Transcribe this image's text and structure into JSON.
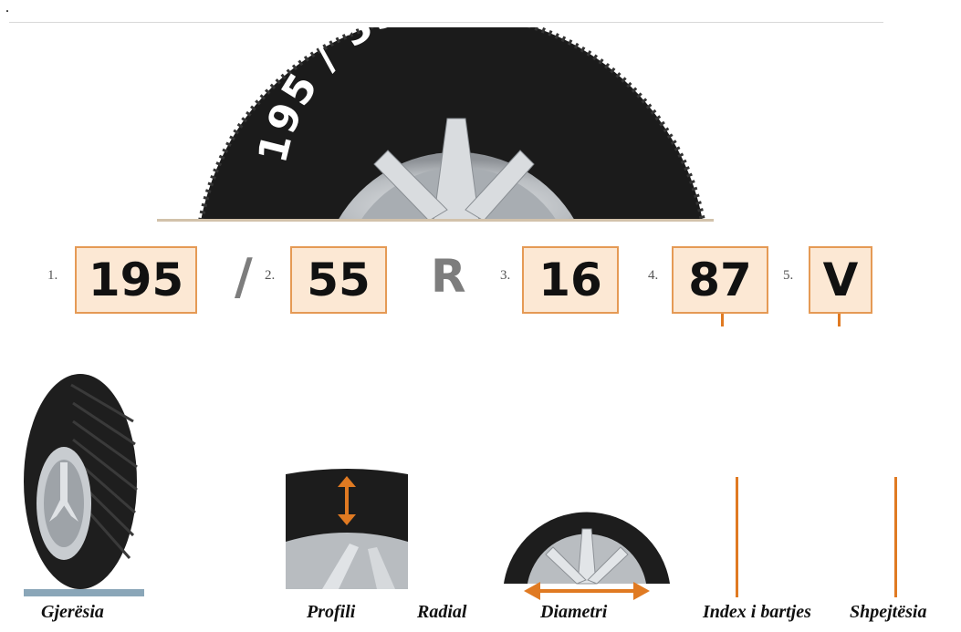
{
  "stray_mark": ".",
  "sidewall_code": "195 / 55 R 16 87V",
  "code": {
    "items": [
      {
        "number": "1.",
        "value": "195"
      },
      {
        "number": "2.",
        "value": "55"
      },
      {
        "number": "3.",
        "value": "16"
      },
      {
        "number": "4.",
        "value": "87"
      },
      {
        "number": "5.",
        "value": "V"
      }
    ],
    "slash": "/",
    "radial_letter": "R"
  },
  "captions": {
    "width": "Gjerësia",
    "profile": "Profili",
    "radial": "Radial",
    "diameter": "Diametri",
    "load_index": "Index i bartjes",
    "speed": "Shpejtësia"
  },
  "colors": {
    "box_fill": "#fce8d4",
    "box_border": "#e59a55",
    "accent_orange": "#e07a22",
    "tire_black": "#1b1b1b",
    "rim_silver": "#bfc3c7"
  },
  "icons": [
    "tire-sidewall-illustration",
    "full-tire-icon",
    "tire-profile-cross-section-icon",
    "half-wheel-diameter-icon"
  ]
}
